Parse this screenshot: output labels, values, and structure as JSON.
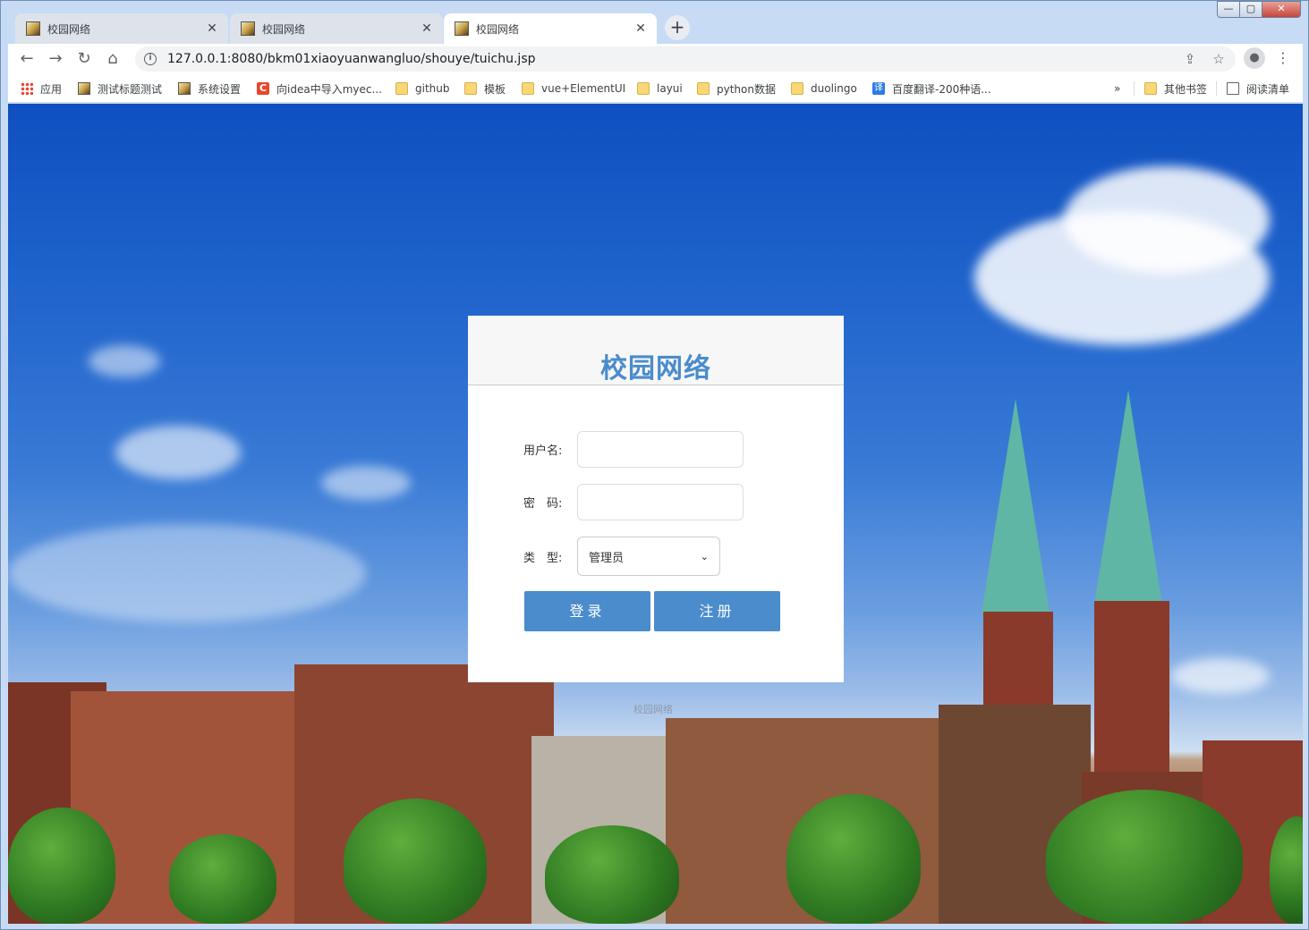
{
  "window": {
    "tabs": [
      {
        "title": "校园网络",
        "active": false
      },
      {
        "title": "校园网络",
        "active": false
      },
      {
        "title": "校园网络",
        "active": true
      }
    ],
    "new_tab_icon": "+",
    "controls": {
      "minimize": "—",
      "maximize": "▢",
      "close": "✕"
    }
  },
  "toolbar": {
    "back_icon": "←",
    "forward_icon": "→",
    "reload_icon": "↻",
    "home_icon": "⌂",
    "info_icon": "i",
    "url": "127.0.0.1:8080/bkm01xiaoyuanwangluo/shouye/tuichu.jsp",
    "share_icon": "⇪",
    "star_icon": "☆",
    "profile_icon": "●",
    "menu_icon": "⋮"
  },
  "bookmarks": {
    "items": [
      {
        "label": "应用",
        "icon": "apps"
      },
      {
        "label": "测试标题测试",
        "icon": "page"
      },
      {
        "label": "系统设置",
        "icon": "page"
      },
      {
        "label": "向idea中导入myec...",
        "icon": "red"
      },
      {
        "label": "github",
        "icon": "folder"
      },
      {
        "label": "模板",
        "icon": "folder"
      },
      {
        "label": "vue+ElementUI",
        "icon": "folder"
      },
      {
        "label": "layui",
        "icon": "folder"
      },
      {
        "label": "python数据",
        "icon": "folder"
      },
      {
        "label": "duolingo",
        "icon": "folder"
      },
      {
        "label": "百度翻译-200种语...",
        "icon": "blue"
      }
    ],
    "overflow": "»",
    "other": "其他书签",
    "reading_list": "阅读清单",
    "red_glyph": "C",
    "blue_glyph": "译"
  },
  "login": {
    "title": "校园网络",
    "username_label": "用户名:",
    "password_label": "密　码:",
    "type_label": "类　型:",
    "username_value": "",
    "password_value": "",
    "type_selected": "管理员",
    "chevron_icon": "⌄",
    "login_button": "登录",
    "register_button": "注册"
  },
  "footer": {
    "text": "校园网络"
  },
  "colors": {
    "accent": "#4a8ccc",
    "sky": "#1f63cc"
  }
}
